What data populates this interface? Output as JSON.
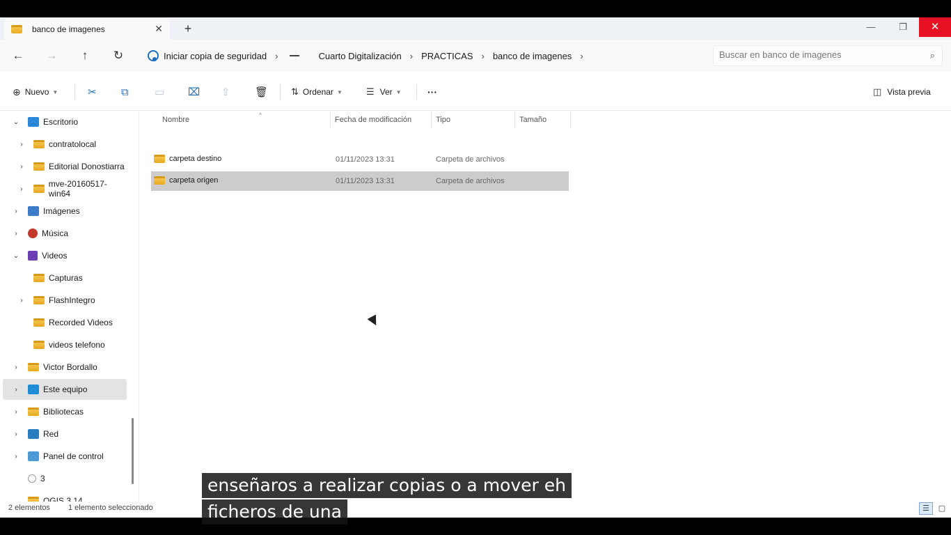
{
  "tab": {
    "title": "banco de imagenes",
    "close": "✕",
    "new": "+"
  },
  "window_controls": {
    "minimize": "—",
    "maximize": "❐",
    "close": "✕"
  },
  "nav": {
    "back": "←",
    "forward": "→",
    "up": "↑",
    "refresh": "↻"
  },
  "breadcrumb": [
    "Iniciar copia de seguridad",
    "Cuarto Digitalización",
    "PRACTICAS",
    "banco de imagenes"
  ],
  "search": {
    "placeholder": "Buscar en banco de imagenes"
  },
  "toolbar": {
    "new_label": "Nuevo",
    "sort_label": "Ordenar",
    "view_label": "Ver",
    "more_label": "···",
    "preview_label": "Vista previa"
  },
  "sidebar": {
    "items": [
      {
        "label": "Escritorio",
        "icon": "desktop-icon",
        "expanded": true
      },
      {
        "label": "contratolocal",
        "icon": "folder-icon"
      },
      {
        "label": "Editorial Donostiarra",
        "icon": "folder-icon"
      },
      {
        "label": "mve-20160517-win64",
        "icon": "folder-icon"
      },
      {
        "label": "Imágenes",
        "icon": "pictures-icon"
      },
      {
        "label": "Música",
        "icon": "music-icon"
      },
      {
        "label": "Videos",
        "icon": "videos-icon",
        "expanded": true
      },
      {
        "label": "Capturas",
        "icon": "folder-icon"
      },
      {
        "label": "FlashIntegro",
        "icon": "folder-icon"
      },
      {
        "label": "Recorded Videos",
        "icon": "folder-icon"
      },
      {
        "label": "videos telefono",
        "icon": "folder-icon"
      },
      {
        "label": "Victor Bordallo",
        "icon": "folder-icon"
      },
      {
        "label": "Este equipo",
        "icon": "pc-icon",
        "selected": true
      },
      {
        "label": "Bibliotecas",
        "icon": "folder-icon"
      },
      {
        "label": "Red",
        "icon": "network-icon"
      },
      {
        "label": "Panel de control",
        "icon": "control-panel-icon"
      },
      {
        "label": "3",
        "icon": "onedrive-icon"
      },
      {
        "label": "QGIS 3.14",
        "icon": "folder-icon"
      }
    ]
  },
  "columns": {
    "name": "Nombre",
    "date": "Fecha de modificación",
    "type": "Tipo",
    "size": "Tamaño"
  },
  "files": [
    {
      "name": "carpeta destino",
      "date": "01/11/2023 13:31",
      "type": "Carpeta de archivos",
      "size": ""
    },
    {
      "name": "carpeta origen",
      "date": "01/11/2023 13:31",
      "type": "Carpeta de archivos",
      "size": "",
      "selected": true
    }
  ],
  "status": {
    "count": "2 elementos",
    "selection": "1 elemento seleccionado"
  },
  "captions": [
    "enseñaros a realizar copias o a mover eh",
    "ficheros de una"
  ],
  "colors": {
    "accent": "#1f6fbf",
    "close_red": "#e81123",
    "selection": "#cccccc"
  }
}
